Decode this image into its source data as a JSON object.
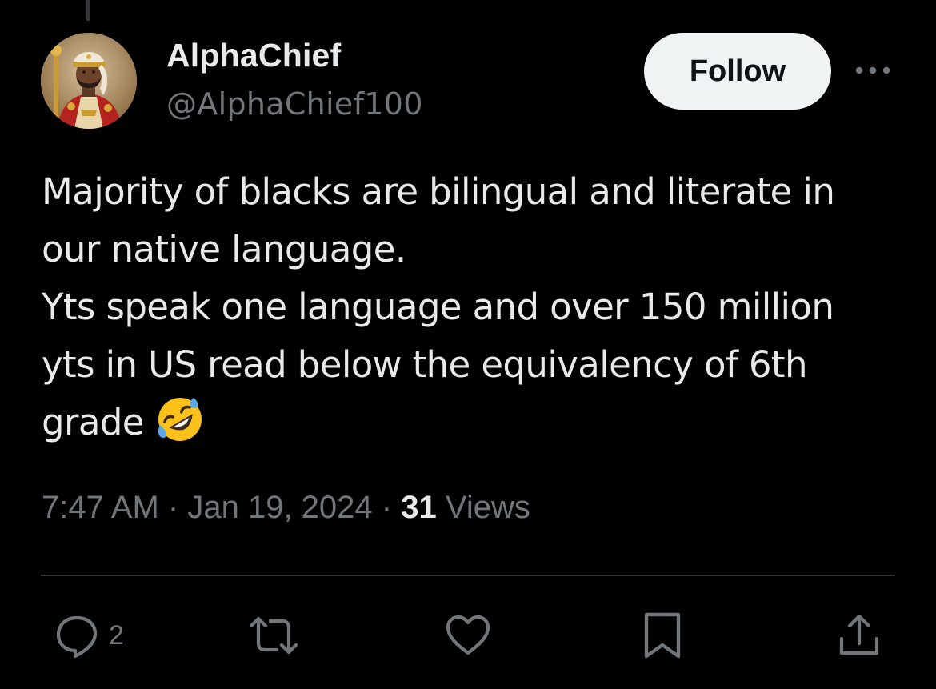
{
  "tweet": {
    "author": {
      "display_name": "AlphaChief",
      "handle": "@AlphaChief100",
      "avatar_icon": "avatar-portrait"
    },
    "follow_label": "Follow",
    "text_lines": [
      "Majority of blacks are bilingual and literate in",
      "our native language.",
      "Yts speak one language and over 150 million",
      "yts in US read below the equivalency of 6th",
      "grade"
    ],
    "emoji": "rolling-on-the-floor-laughing",
    "time": "7:47 AM",
    "date": "Jan 19, 2024",
    "separator": "·",
    "views_count": "31",
    "views_label": "Views",
    "actions": {
      "reply_count": "2",
      "reply_icon": "reply-icon",
      "retweet_icon": "retweet-icon",
      "like_icon": "heart-icon",
      "bookmark_icon": "bookmark-icon",
      "share_icon": "share-icon"
    }
  },
  "colors": {
    "background": "#000000",
    "primary_text": "#e7e9ea",
    "secondary_text": "#71767b",
    "divider": "#2f3336",
    "follow_bg": "#eff3f4",
    "follow_text": "#0f1419"
  }
}
